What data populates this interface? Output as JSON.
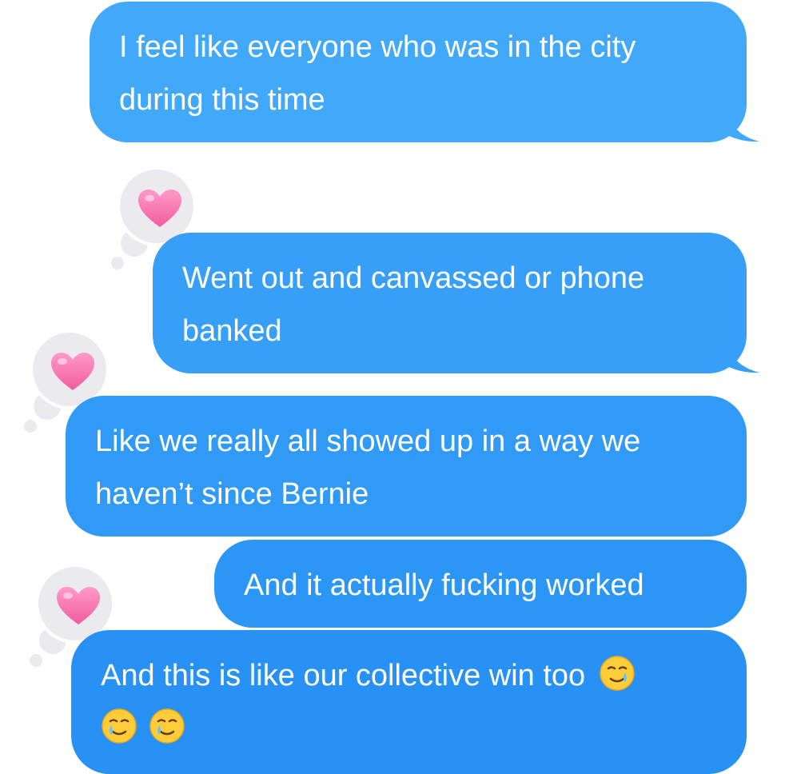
{
  "messages": [
    {
      "id": 1,
      "lines": [
        "I feel like everyone who was in the city",
        "during this time"
      ],
      "reaction": null,
      "color": "#42a8fa"
    },
    {
      "id": 2,
      "lines": [
        "Went out and canvassed or phone",
        "banked"
      ],
      "reaction": "heart",
      "color": "#379ff8"
    },
    {
      "id": 3,
      "lines": [
        "Like we really all showed up in a way we",
        "haven’t since Bernie"
      ],
      "reaction": "heart",
      "color": "#319af7"
    },
    {
      "id": 4,
      "lines": [
        "And it actually fucking worked"
      ],
      "reaction": null,
      "color": "#2c96f7"
    },
    {
      "id": 5,
      "lines": [
        "And this is like our collective win too"
      ],
      "emoji_after": "smiling-face-with-tear",
      "emoji_line": [
        "smiling-face-with-tear",
        "smiling-face-with-tear"
      ],
      "reaction": "heart",
      "color": "#2891f6"
    }
  ],
  "reaction_icon": "heart-icon",
  "reaction_color": "#f26ca6",
  "tapback_bg": "#ebebef"
}
